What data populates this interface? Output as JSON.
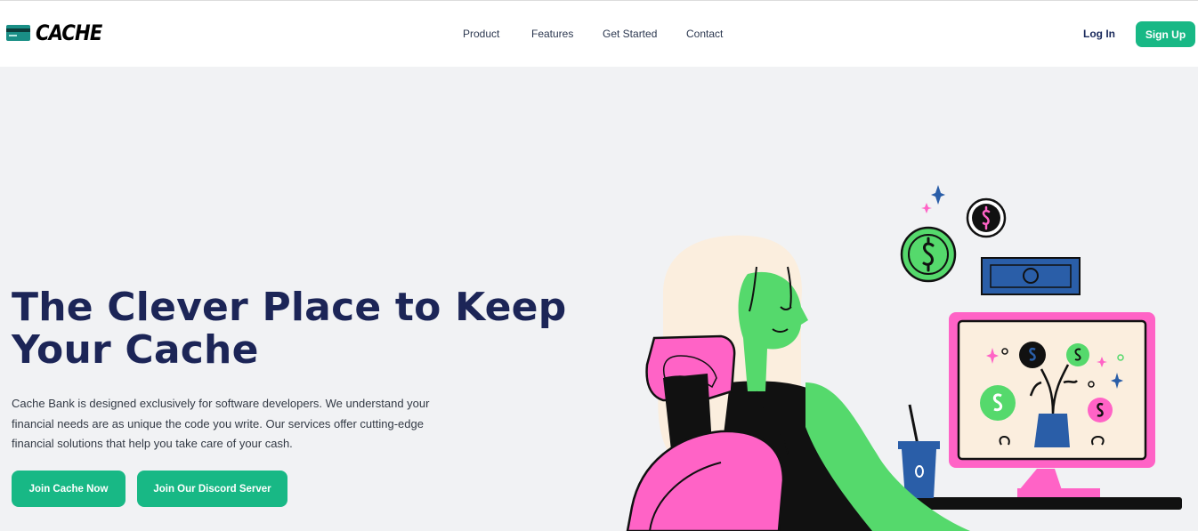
{
  "brand": {
    "name": "CACHE"
  },
  "nav": {
    "links": [
      "Product",
      "Features",
      "Get Started",
      "Contact"
    ],
    "login_label": "Log In",
    "signup_label": "Sign Up"
  },
  "hero": {
    "title": "The Clever Place to Keep Your Cache",
    "description": "Cache Bank is designed exclusively for software developers. We understand your financial needs are as unique the code you write. Our services offer cutting-edge financial solutions that help you take care of your cash.",
    "cta_primary": "Join Cache Now",
    "cta_secondary": "Join Our Discord Server"
  },
  "colors": {
    "accent": "#18b885",
    "heading": "#1c2557",
    "background": "#f1f2f4",
    "pink": "#ff63c6",
    "green": "#55d96c",
    "blue": "#2a5ea8"
  },
  "icons": [
    "credit-card-icon"
  ],
  "illustration": {
    "subject": "person-at-computer-with-coins-illustration"
  }
}
